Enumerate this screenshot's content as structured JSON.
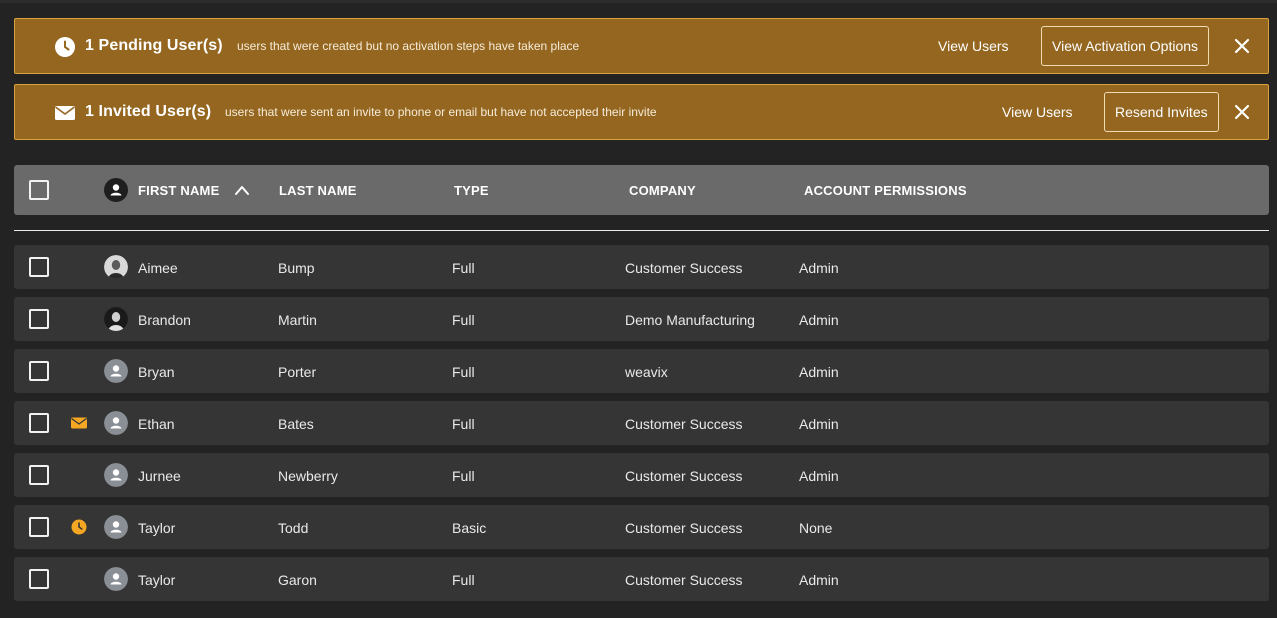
{
  "colors": {
    "banner_bg": "#946620",
    "banner_border": "#d9a23a",
    "status_accent": "#f5a623",
    "header_bg": "#6a6a6a",
    "row_bg": "#353535"
  },
  "banners": {
    "pending": {
      "icon": "clock-icon",
      "title": "1 Pending User(s)",
      "description": "users that were created but no activation steps have taken place",
      "link": "View Users",
      "button": "View Activation Options",
      "close": "close-icon"
    },
    "invited": {
      "icon": "envelope-icon",
      "title": "1 Invited User(s)",
      "description": "users that were sent an invite to phone or email but have not accepted their invite",
      "link": "View Users",
      "button": "Resend Invites",
      "close": "close-icon"
    }
  },
  "table": {
    "columns": [
      "FIRST NAME",
      "LAST NAME",
      "TYPE",
      "COMPANY",
      "ACCOUNT PERMISSIONS"
    ],
    "sort": {
      "column": "FIRST NAME",
      "direction": "asc",
      "icon": "chevron-up-icon"
    },
    "rows": [
      {
        "first": "Aimee",
        "last": "Bump",
        "type": "Full",
        "company": "Customer Success",
        "permissions": "Admin",
        "avatar": "photo",
        "status": ""
      },
      {
        "first": "Brandon",
        "last": "Martin",
        "type": "Full",
        "company": "Demo Manufacturing",
        "permissions": "Admin",
        "avatar": "photo",
        "status": ""
      },
      {
        "first": "Bryan",
        "last": "Porter",
        "type": "Full",
        "company": "weavix",
        "permissions": "Admin",
        "avatar": "default",
        "status": ""
      },
      {
        "first": "Ethan",
        "last": "Bates",
        "type": "Full",
        "company": "Customer Success",
        "permissions": "Admin",
        "avatar": "default",
        "status": "invited"
      },
      {
        "first": "Jurnee",
        "last": "Newberry",
        "type": "Full",
        "company": "Customer Success",
        "permissions": "Admin",
        "avatar": "default",
        "status": ""
      },
      {
        "first": "Taylor",
        "last": "Todd",
        "type": "Basic",
        "company": "Customer Success",
        "permissions": "None",
        "avatar": "default",
        "status": "pending"
      },
      {
        "first": "Taylor",
        "last": "Garon",
        "type": "Full",
        "company": "Customer Success",
        "permissions": "Admin",
        "avatar": "default",
        "status": ""
      }
    ]
  }
}
